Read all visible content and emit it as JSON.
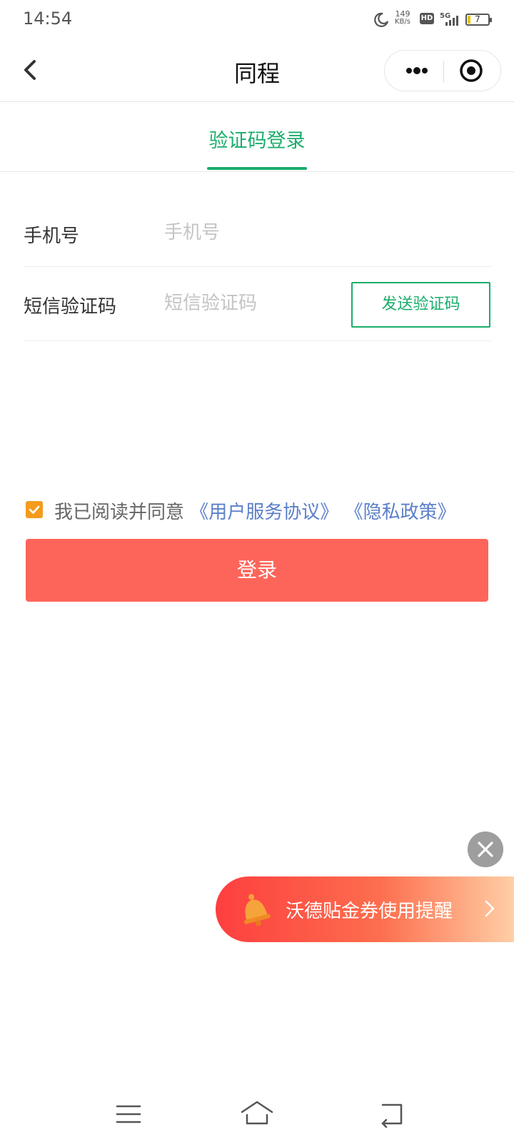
{
  "status_bar": {
    "time": "14:54",
    "net_speed_value": "149",
    "net_speed_unit": "KB/s",
    "hd_label": "HD",
    "network_label": "5G",
    "battery_level": "7",
    "icons": [
      "moon-icon",
      "hd-icon",
      "signal-icon",
      "battery-icon"
    ]
  },
  "nav": {
    "title": "同程",
    "back_icon": "chevron-left-icon",
    "more_icon": "more-dots-icon",
    "close_icon": "target-close-icon"
  },
  "tabs": [
    {
      "label": "验证码登录",
      "active": true
    }
  ],
  "form": {
    "phone": {
      "label": "手机号",
      "placeholder": "手机号",
      "value": ""
    },
    "sms": {
      "label": "短信验证码",
      "placeholder": "短信验证码",
      "value": "",
      "send_button": "发送验证码"
    }
  },
  "agreement": {
    "checked": true,
    "prefix": "我已阅读并同意",
    "link_terms": "《用户服务协议》",
    "link_privacy": "《隐私政策》"
  },
  "login_button": "登录",
  "floating": {
    "coupon_text": "沃德贴金券使用提醒",
    "close_icon": "close-x-icon",
    "bell_icon": "bell-icon"
  },
  "bottom_nav": {
    "icons": [
      "menu-icon",
      "home-icon",
      "back-icon"
    ]
  },
  "colors": {
    "accent_green": "#1aad6b",
    "login_red": "#fe655a",
    "link_blue": "#5b7fc9",
    "checkbox_orange": "#f39c1d"
  }
}
